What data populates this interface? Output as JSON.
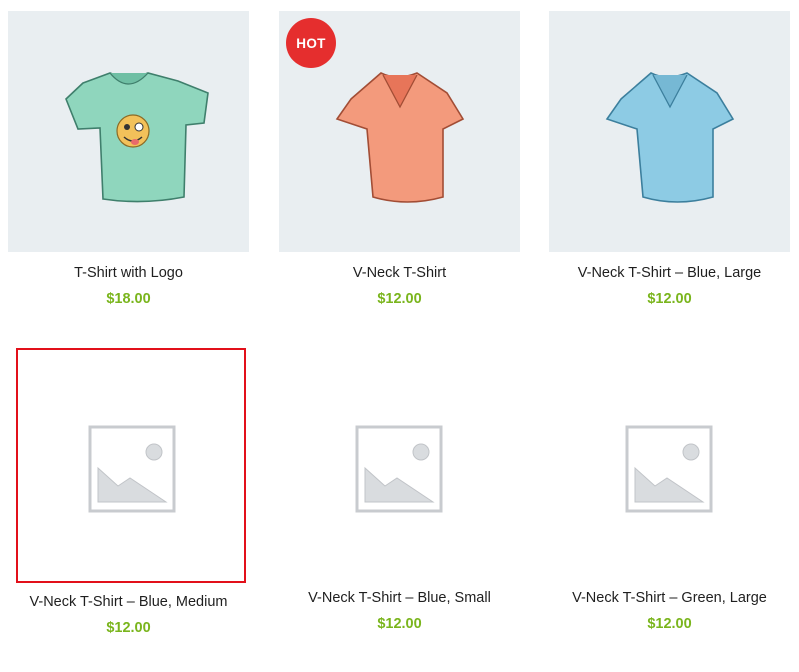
{
  "products": [
    {
      "title": "T-Shirt with Logo",
      "price": "$18.00",
      "badge": "",
      "image": "tshirt-green-logo-icon"
    },
    {
      "title": "V-Neck T-Shirt",
      "price": "$12.00",
      "badge": "HOT",
      "image": "tshirt-red-vneck-icon"
    },
    {
      "title": "V-Neck T-Shirt – Blue, Large",
      "price": "$12.00",
      "badge": "",
      "image": "tshirt-blue-vneck-icon"
    },
    {
      "title": "V-Neck T-Shirt – Blue, Medium",
      "price": "$12.00",
      "badge": "",
      "image": "image-placeholder-icon"
    },
    {
      "title": "V-Neck T-Shirt – Blue, Small",
      "price": "$12.00",
      "badge": "",
      "image": "image-placeholder-icon"
    },
    {
      "title": "V-Neck T-Shirt – Green, Large",
      "price": "$12.00",
      "badge": "",
      "image": "image-placeholder-icon"
    }
  ],
  "colors": {
    "price": "#7ab51d",
    "badge": "#e52e2e",
    "selection_outline": "#e2101a",
    "tile_background": "#e9eef1"
  }
}
